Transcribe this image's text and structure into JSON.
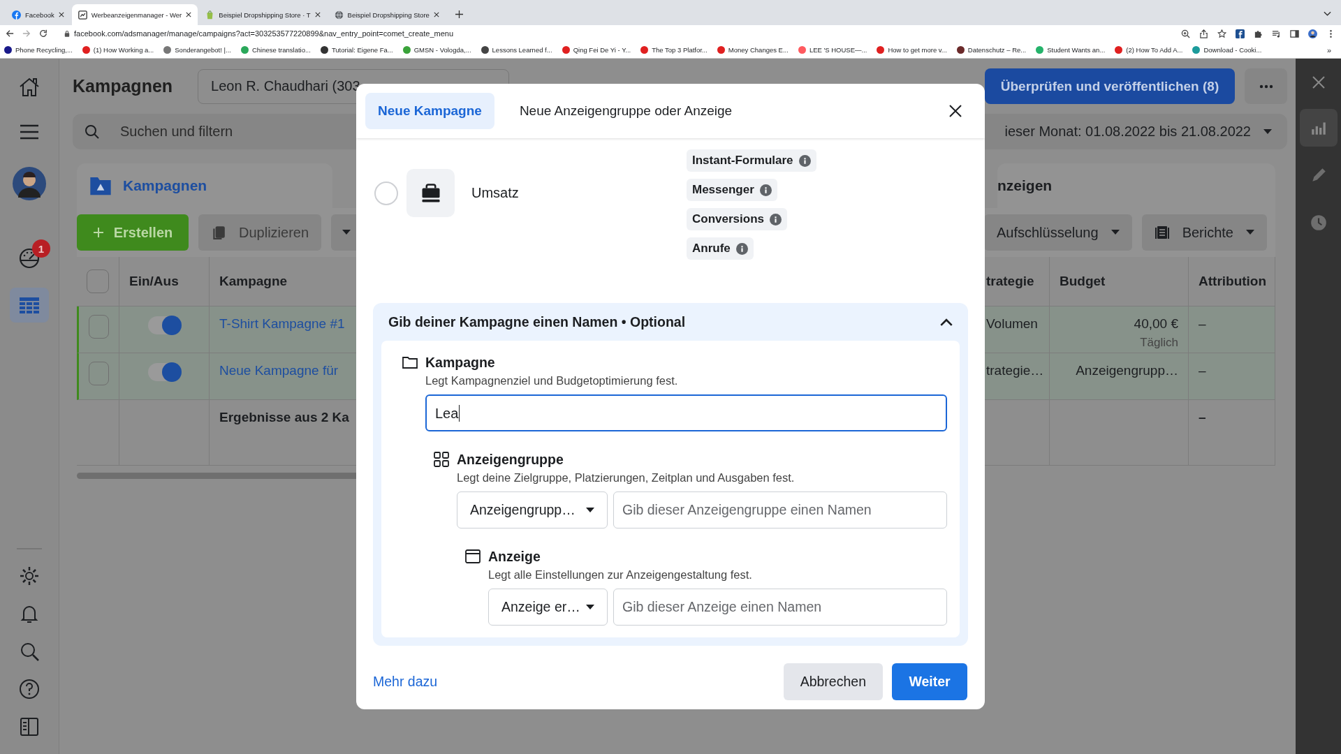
{
  "browser": {
    "tabs": [
      {
        "title": "Facebook",
        "selected": false
      },
      {
        "title": "Werbeanzeigenmanager - Wer",
        "selected": true
      },
      {
        "title": "Beispiel Dropshipping Store · T",
        "selected": false
      },
      {
        "title": "Beispiel Dropshipping Store",
        "selected": false
      }
    ],
    "url": "facebook.com/adsmanager/manage/campaigns?act=303253577220899&nav_entry_point=comet_create_menu",
    "bookmarks": [
      "Phone Recycling,...",
      "(1) How Working a...",
      "Sonderangebot! |...",
      "Chinese translatio...",
      "Tutorial: Eigene Fa...",
      "GMSN - Vologda,...",
      "Lessons Learned f...",
      "Qing Fei De Yi - Y...",
      "The Top 3 Platfor...",
      "Money Changes E...",
      "LEE 'S HOUSE—...",
      "How to get more v...",
      "Datenschutz – Re...",
      "Student Wants an...",
      "(2) How To Add A...",
      "Download - Cooki..."
    ],
    "bookmarks_overflow": "»"
  },
  "nav": [
    {
      "selected": false,
      "badge": "1"
    },
    {
      "selected": true
    }
  ],
  "side_panel": [
    {
      "selected": true
    },
    {
      "selected": false
    },
    {
      "selected": false
    }
  ],
  "page": {
    "title": "Kampagnen",
    "account": "Leon R. Chaudhari (303",
    "publish_button": "Überprüfen und veröffentlichen (8)",
    "search_placeholder": "Suchen und filtern",
    "date_range": "ieser Monat: 01.08.2022 bis 21.08.2022",
    "level_tabs": [
      {
        "label": "Kampagnen",
        "selected": true
      },
      {
        "label": "nzeigen",
        "selected": false
      }
    ],
    "toolbar": {
      "create": "Erstellen",
      "duplicate": "Duplizieren",
      "breakdown": "Aufschlüsselung",
      "reports": "Berichte"
    },
    "table": {
      "select_all_checked": false,
      "columns_left": [
        "Ein/Aus",
        "Kampagne"
      ],
      "columns_right": [
        "trategie",
        "Budget",
        "Attribution"
      ],
      "rows": [
        {
          "checked": false,
          "highlighted": true,
          "on": true,
          "name": "T-Shirt Kampagne #1",
          "strategy": "Volumen",
          "budget": "40,00 €",
          "budget_note": "Täglich",
          "attribution": "–"
        },
        {
          "checked": false,
          "highlighted": true,
          "on": true,
          "name": "Neue Kampagne für",
          "strategy": "trategie…",
          "budget": "Anzeigengrupp…",
          "attribution": "–"
        }
      ],
      "summary": {
        "label": "Ergebnisse aus 2 Ka",
        "attribution": "–"
      }
    }
  },
  "dialog": {
    "tabs": [
      {
        "label": "Neue Kampagne",
        "selected": true
      },
      {
        "label": "Neue Anzeigengruppe oder Anzeige",
        "selected": false
      }
    ],
    "objectives": [
      {
        "label": "Umsatz",
        "selected": false
      }
    ],
    "chips": [
      "Instant-Formulare",
      "Messenger",
      "Conversions",
      "Anrufe"
    ],
    "naming": {
      "title": "Gib deiner Kampagne einen Namen • Optional",
      "expanded": true,
      "level": {
        "kind": "name",
        "title": "Kampagne",
        "description": "Legt Kampagnenziel und Budgetoptimierung fest.",
        "value": "Lea",
        "children": [
          {
            "kind": "select",
            "title": "Anzeigengruppe",
            "description": "Legt deine Zielgruppe, Platzierungen, Zeitplan und Ausgaben fest.",
            "select": "Anzeigengrupp…",
            "placeholder": "Gib dieser Anzeigengruppe einen Namen",
            "children": [
              {
                "kind": "select",
                "title": "Anzeige",
                "description": "Legt alle Einstellungen zur Anzeigengestaltung fest.",
                "select": "Anzeige er…",
                "placeholder": "Gib dieser Anzeige einen Namen"
              }
            ]
          }
        ]
      }
    },
    "learn_more": "Mehr dazu",
    "cancel": "Abbrechen",
    "next": "Weiter"
  }
}
